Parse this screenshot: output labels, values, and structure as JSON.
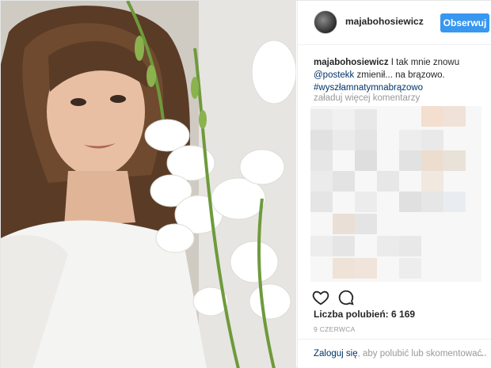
{
  "post": {
    "username": "majabohosiewicz",
    "follow_label": "Obserwuj",
    "caption": {
      "author": "majabohosiewicz",
      "text_1": "I tak mnie znowu",
      "mention": "@postekk",
      "text_2": "zmienił... na brązowo.",
      "hashtag": "#wyszłamnatymnabrązowo"
    },
    "load_more_comments": "załaduj więcej komentarzy",
    "likes_label": "Liczba polubień:",
    "likes_count": "6 169",
    "date": "9 CZERWCA",
    "footer": {
      "login_link": "Zaloguj się",
      "rest": ", aby polubić lub skomentować."
    }
  },
  "colors": {
    "follow_button": "#3897f0",
    "link": "#003569",
    "muted": "#999999"
  },
  "icons": {
    "like": "heart-icon",
    "comment": "comment-icon",
    "more": "ellipsis-icon"
  }
}
